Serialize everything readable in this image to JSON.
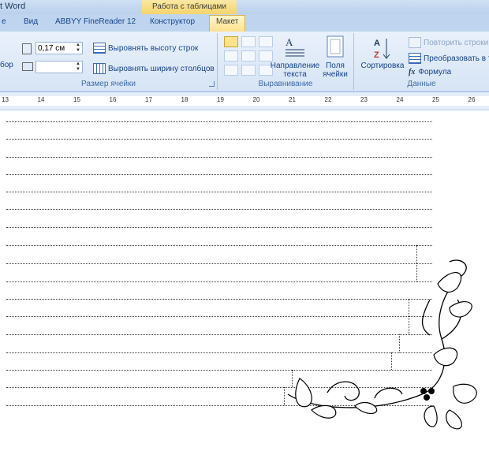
{
  "window": {
    "title_fragment": "t Word",
    "context_title": "Работа с таблицами"
  },
  "tabs": [
    {
      "label": "е"
    },
    {
      "label": "Вид"
    },
    {
      "label": "ABBYY FineReader 12"
    },
    {
      "label": "Конструктор"
    },
    {
      "label": "Макет"
    }
  ],
  "cell_size": {
    "group_label": "Размер ячейки",
    "fit_fragment": "бор",
    "height_value": "0,17 см",
    "width_value": "",
    "distribute_rows": "Выровнять высоту строк",
    "distribute_cols": "Выровнять ширину столбцов"
  },
  "alignment": {
    "group_label": "Выравнивание",
    "text_direction_line1": "Направление",
    "text_direction_line2": "текста",
    "margins_line1": "Поля",
    "margins_line2": "ячейки"
  },
  "data": {
    "group_label": "Данные",
    "sort_label": "Сортировка",
    "repeat_header": "Повторить строки",
    "convert": "Преобразовать в т",
    "formula": "Формула"
  },
  "ruler": {
    "numbers": [
      "13",
      "14",
      "15",
      "16",
      "17",
      "18",
      "19",
      "20",
      "21",
      "22",
      "23",
      "24",
      "25",
      "26"
    ]
  }
}
